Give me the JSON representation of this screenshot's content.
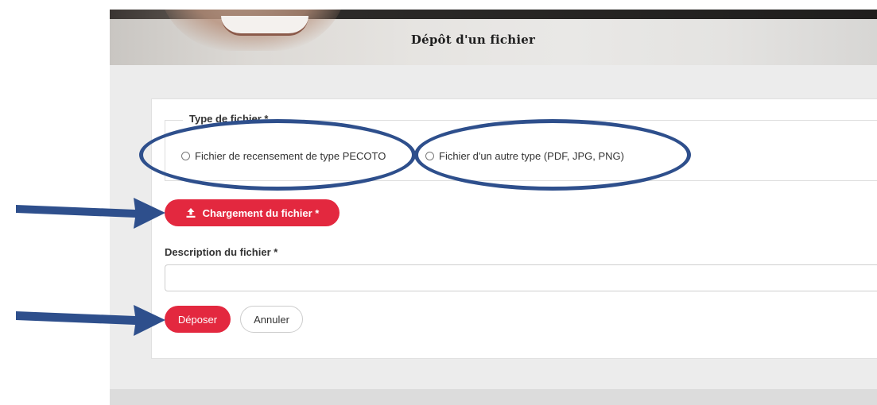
{
  "header": {
    "title": "Dépôt d'un fichier"
  },
  "form": {
    "file_type": {
      "legend": "Type de fichier *",
      "options": [
        {
          "label": "Fichier de recensement de type PECOTO",
          "selected": false
        },
        {
          "label": "Fichier d'un autre type (PDF, JPG, PNG)",
          "selected": false
        }
      ]
    },
    "upload_button_label": "Chargement du fichier *",
    "description_label": "Description du fichier *",
    "description_value": "",
    "submit_label": "Déposer",
    "cancel_label": "Annuler"
  },
  "icons": {
    "upload": "upload-icon",
    "radio": "radio-unchecked-icon"
  },
  "colors": {
    "accent": "#e3283f",
    "annotation": "#2e4f8c",
    "page_background": "#ececec"
  }
}
